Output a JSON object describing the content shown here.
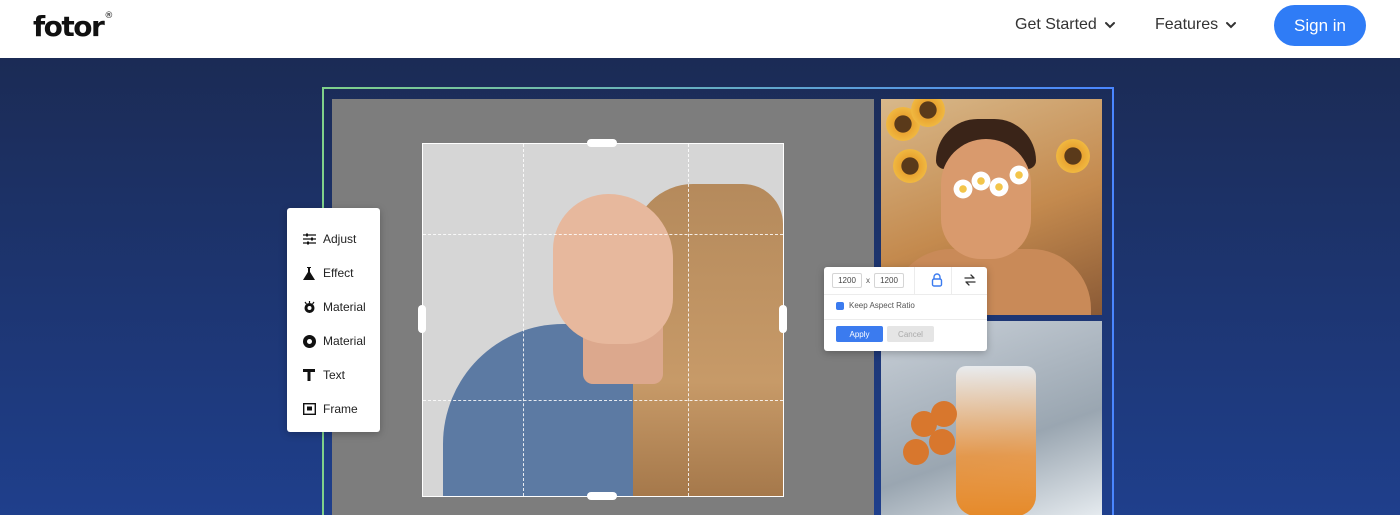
{
  "header": {
    "logo": "fotor",
    "logo_mark": "®",
    "nav": [
      {
        "label": "Get Started",
        "icon": "chevron-down-icon"
      },
      {
        "label": "Features",
        "icon": "chevron-down-icon"
      }
    ],
    "signin_label": "Sign in"
  },
  "colors": {
    "accent": "#2f7cf6",
    "hero_top": "#1b2b55",
    "hero_bottom": "#1f3f8c"
  },
  "tools": [
    {
      "label": "Adjust",
      "icon": "sliders-icon"
    },
    {
      "label": "Effect",
      "icon": "flask-icon"
    },
    {
      "label": "Material",
      "icon": "eye-sticker-icon"
    },
    {
      "label": "Material",
      "icon": "circle-icon"
    },
    {
      "label": "Text",
      "icon": "text-icon"
    },
    {
      "label": "Frame",
      "icon": "frame-icon"
    }
  ],
  "resize": {
    "width": "1200",
    "separator": "x",
    "height": "1200",
    "keep_ratio_label": "Keep Aspect Ratio",
    "apply_label": "Apply",
    "cancel_label": "Cancel"
  }
}
